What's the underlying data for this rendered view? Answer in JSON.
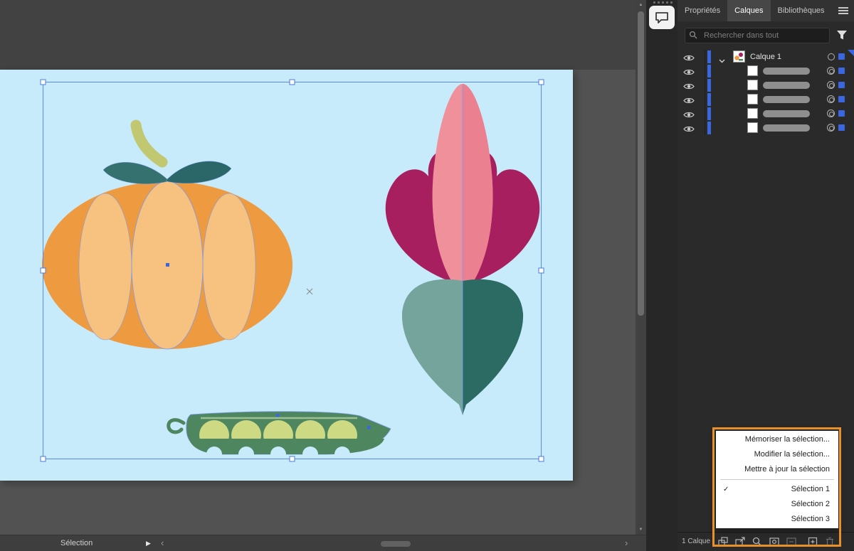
{
  "colors": {
    "accent_blue": "#3a66e0",
    "highlight_orange": "#e8912b",
    "artboard_bg": "#c7ebfa"
  },
  "panel": {
    "tabs": [
      {
        "label": "Propriétés",
        "active": false
      },
      {
        "label": "Calques",
        "active": true
      },
      {
        "label": "Bibliothèques",
        "active": false
      }
    ],
    "search_placeholder": "Rechercher dans tout",
    "layer_name": "Calque 1",
    "sublayer_count": 5,
    "footer_count": "1 Calque"
  },
  "context_menu": {
    "actions": [
      {
        "label": "Mémoriser la sélection..."
      },
      {
        "label": "Modifier la sélection..."
      },
      {
        "label": "Mettre à jour la sélection"
      }
    ],
    "selections": [
      {
        "label": "Sélection 1",
        "checked": true
      },
      {
        "label": "Sélection 2",
        "checked": false
      },
      {
        "label": "Sélection 3",
        "checked": false
      }
    ]
  },
  "status_bar": {
    "tool_label": "Sélection"
  },
  "icons": {
    "check": "✓",
    "play": "▶",
    "chevron_left": "‹",
    "chevron_right": "›",
    "scroll_up": "▲",
    "scroll_down": "▼"
  }
}
